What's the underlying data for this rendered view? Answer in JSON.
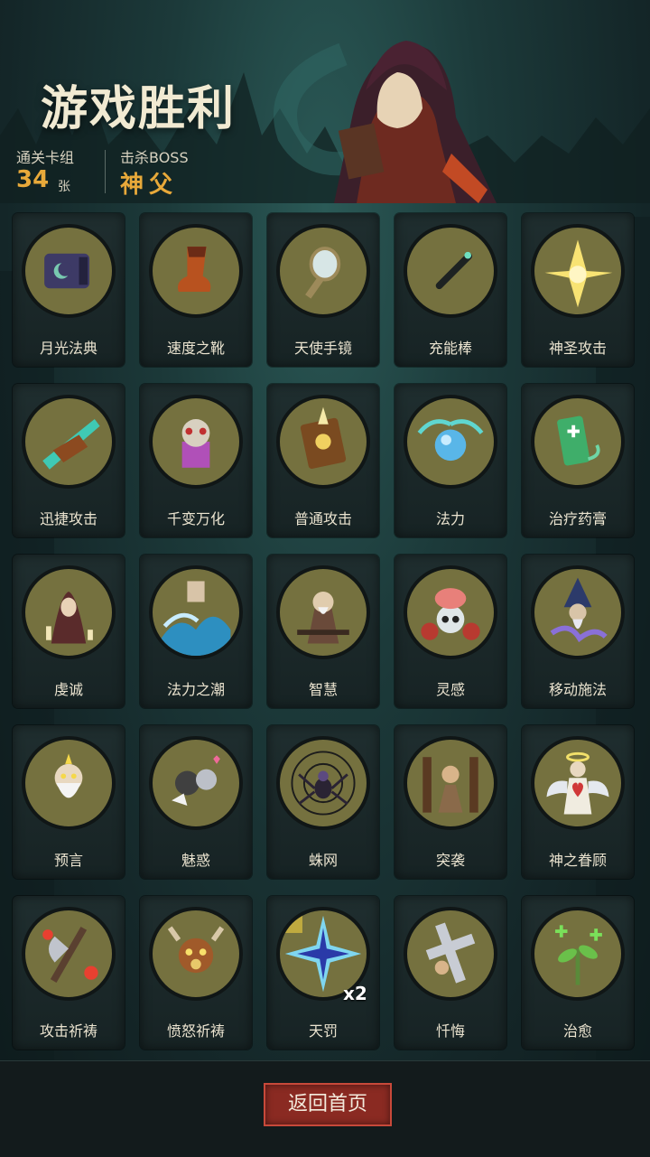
{
  "header": {
    "title": "游戏胜利",
    "cleared_deck_label": "通关卡组",
    "cleared_deck_value": "34",
    "cleared_deck_unit": "张",
    "boss_label": "击杀BOSS",
    "boss_value": "神父"
  },
  "cards": [
    {
      "label": "月光法典",
      "icon": "grimoire-icon"
    },
    {
      "label": "速度之靴",
      "icon": "boot-icon"
    },
    {
      "label": "天使手镜",
      "icon": "hand-mirror-icon"
    },
    {
      "label": "充能棒",
      "icon": "wand-icon"
    },
    {
      "label": "神圣攻击",
      "icon": "holy-strike-icon"
    },
    {
      "label": "迅捷攻击",
      "icon": "swift-strike-icon"
    },
    {
      "label": "千变万化",
      "icon": "shapeshift-icon"
    },
    {
      "label": "普通攻击",
      "icon": "spellbook-strike-icon"
    },
    {
      "label": "法力",
      "icon": "mana-orb-icon"
    },
    {
      "label": "治疗药膏",
      "icon": "healing-ointment-icon"
    },
    {
      "label": "虔诚",
      "icon": "praying-nun-icon"
    },
    {
      "label": "法力之潮",
      "icon": "mana-tide-icon"
    },
    {
      "label": "智慧",
      "icon": "sage-icon"
    },
    {
      "label": "灵感",
      "icon": "brain-skull-icon"
    },
    {
      "label": "移动施法",
      "icon": "wizard-icon"
    },
    {
      "label": "预言",
      "icon": "prophet-icon"
    },
    {
      "label": "魅惑",
      "icon": "charm-icon"
    },
    {
      "label": "蛛网",
      "icon": "spider-web-icon"
    },
    {
      "label": "突袭",
      "icon": "ambush-icon"
    },
    {
      "label": "神之眷顾",
      "icon": "angel-heart-icon"
    },
    {
      "label": "攻击祈祷",
      "icon": "axe-prayer-icon"
    },
    {
      "label": "愤怒祈祷",
      "icon": "rage-prayer-icon"
    },
    {
      "label": "天罚",
      "icon": "divine-lightning-icon",
      "badge": "x2"
    },
    {
      "label": "忏悔",
      "icon": "repentance-cross-icon"
    },
    {
      "label": "治愈",
      "icon": "healing-sprout-icon"
    }
  ],
  "footer": {
    "return_label": "返回首页"
  }
}
